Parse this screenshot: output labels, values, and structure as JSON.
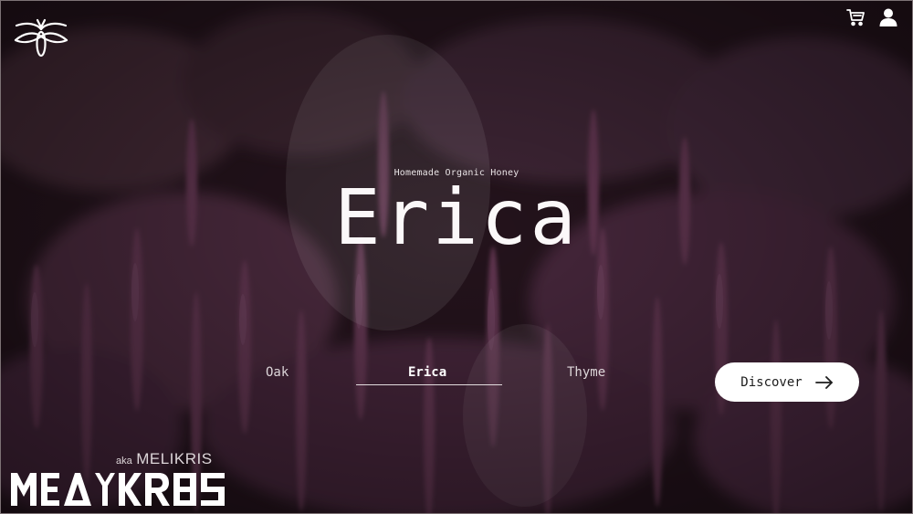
{
  "brand": {
    "wordmark_text": "MEΔIKROS",
    "aka_prefix": "aka",
    "aka_name": "MELIKRIS"
  },
  "header": {
    "icons": [
      "bee-logo-icon",
      "cart-icon",
      "user-icon"
    ]
  },
  "hero": {
    "subtitle": "Homemade Organic Honey",
    "title": "Erica"
  },
  "varieties": {
    "items": [
      "Oak",
      "Erica",
      "Thyme"
    ],
    "selected": "Erica"
  },
  "cta": {
    "label": "Discover",
    "icon": "arrow-right-icon"
  },
  "colors": {
    "overlay": "#2a1720",
    "flowers": "#8c4d73",
    "text": "#ffffff",
    "button_bg": "#ffffff",
    "button_text": "#1d1d1d"
  }
}
